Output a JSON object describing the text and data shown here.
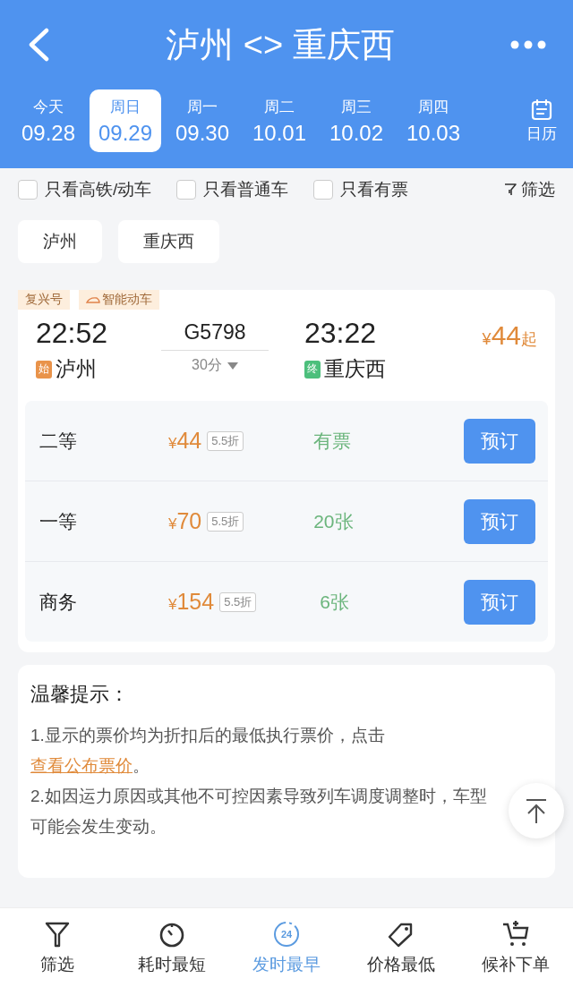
{
  "header": {
    "title": "泸州 <> 重庆西"
  },
  "dates": [
    {
      "weekday": "今天",
      "date": "09.28",
      "selected": false
    },
    {
      "weekday": "周日",
      "date": "09.29",
      "selected": true
    },
    {
      "weekday": "周一",
      "date": "09.30",
      "selected": false
    },
    {
      "weekday": "周二",
      "date": "10.01",
      "selected": false
    },
    {
      "weekday": "周三",
      "date": "10.02",
      "selected": false
    },
    {
      "weekday": "周四",
      "date": "10.03",
      "selected": false
    }
  ],
  "calendar_label": "日历",
  "filters": [
    {
      "label": "只看高铁/动车",
      "checked": false
    },
    {
      "label": "只看普通车",
      "checked": false
    },
    {
      "label": "只看有票",
      "checked": false
    }
  ],
  "filter_button": "筛选",
  "stations": [
    "泸州",
    "重庆西"
  ],
  "train": {
    "tags": [
      {
        "label": "复兴号",
        "icon": false
      },
      {
        "label": "智能动车",
        "icon": true
      }
    ],
    "depart_time": "22:52",
    "depart_mark": "始",
    "depart_station": "泸州",
    "number": "G5798",
    "duration": "30分",
    "arrive_time": "23:22",
    "arrive_mark": "终",
    "arrive_station": "重庆西",
    "price_currency": "¥",
    "price": "44",
    "price_suffix": "起",
    "seats": [
      {
        "class": "二等",
        "currency": "¥",
        "price": "44",
        "discount": "5.5折",
        "availability": "有票",
        "button": "预订"
      },
      {
        "class": "一等",
        "currency": "¥",
        "price": "70",
        "discount": "5.5折",
        "availability": "20张",
        "button": "预订"
      },
      {
        "class": "商务",
        "currency": "¥",
        "price": "154",
        "discount": "5.5折",
        "availability": "6张",
        "button": "预订"
      }
    ]
  },
  "notice": {
    "title": "温馨提示：",
    "items": [
      {
        "text": "1.显示的票价均为折扣后的最低执行票价，点击 ",
        "link": "查看公布票价",
        "after": "。"
      },
      {
        "text": "2.如因运力原因或其他不可控因素导致列车调度调整时，车型可能会发生变动。"
      }
    ]
  },
  "bottom_tabs": [
    {
      "label": "筛选",
      "selected": false
    },
    {
      "label": "耗时最短",
      "selected": false
    },
    {
      "label": "发时最早",
      "selected": true,
      "icon_text": "24"
    },
    {
      "label": "价格最低",
      "selected": false
    },
    {
      "label": "候补下单",
      "selected": false
    }
  ]
}
